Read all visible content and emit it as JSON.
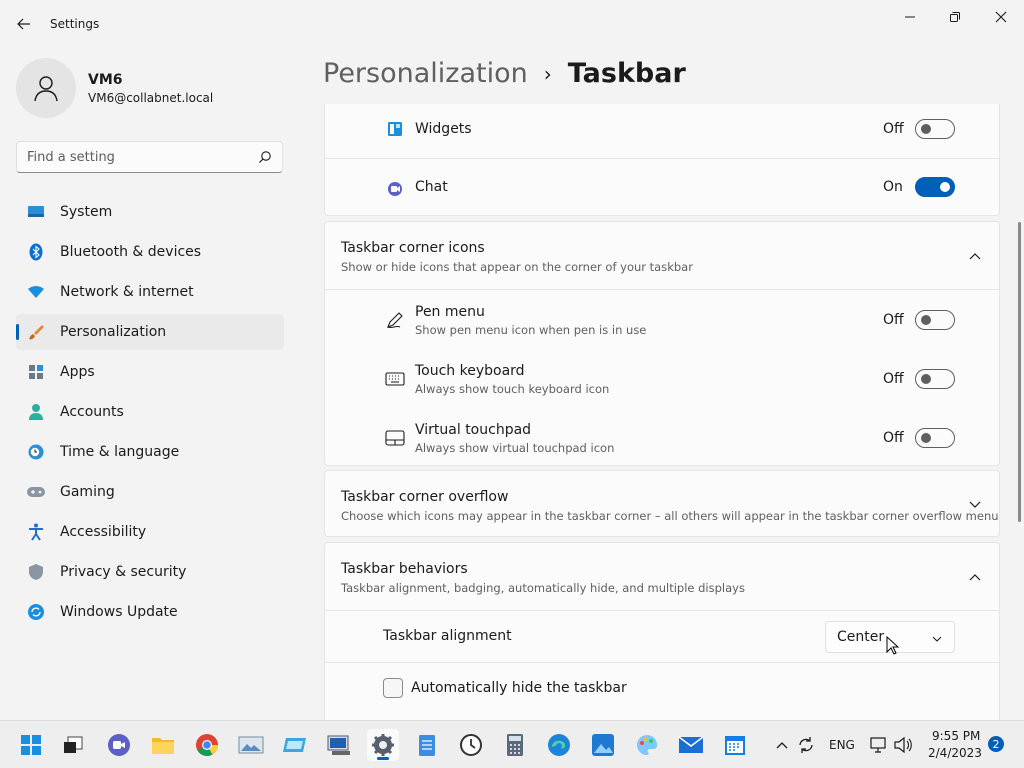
{
  "window": {
    "title": "Settings"
  },
  "profile": {
    "name": "VM6",
    "email": "VM6@collabnet.local"
  },
  "search": {
    "placeholder": "Find a setting"
  },
  "nav": {
    "items": [
      {
        "label": "System",
        "icon": "system-icon"
      },
      {
        "label": "Bluetooth & devices",
        "icon": "bluetooth-icon"
      },
      {
        "label": "Network & internet",
        "icon": "wifi-icon"
      },
      {
        "label": "Personalization",
        "icon": "brush-icon",
        "active": true
      },
      {
        "label": "Apps",
        "icon": "apps-icon"
      },
      {
        "label": "Accounts",
        "icon": "accounts-icon"
      },
      {
        "label": "Time & language",
        "icon": "clock-globe-icon"
      },
      {
        "label": "Gaming",
        "icon": "gamepad-icon"
      },
      {
        "label": "Accessibility",
        "icon": "accessibility-icon"
      },
      {
        "label": "Privacy & security",
        "icon": "shield-icon"
      },
      {
        "label": "Windows Update",
        "icon": "update-icon"
      }
    ]
  },
  "breadcrumb": {
    "parent": "Personalization",
    "separator": "›",
    "current": "Taskbar"
  },
  "taskbar_items": {
    "widgets": {
      "label": "Widgets",
      "state": "Off",
      "on": false
    },
    "chat": {
      "label": "Chat",
      "state": "On",
      "on": true
    }
  },
  "corner_icons": {
    "title": "Taskbar corner icons",
    "subtitle": "Show or hide icons that appear on the corner of your taskbar",
    "items": [
      {
        "label": "Pen menu",
        "sub": "Show pen menu icon when pen is in use",
        "state": "Off"
      },
      {
        "label": "Touch keyboard",
        "sub": "Always show touch keyboard icon",
        "state": "Off"
      },
      {
        "label": "Virtual touchpad",
        "sub": "Always show virtual touchpad icon",
        "state": "Off"
      }
    ]
  },
  "corner_overflow": {
    "title": "Taskbar corner overflow",
    "subtitle": "Choose which icons may appear in the taskbar corner – all others will appear in the taskbar corner overflow menu"
  },
  "behaviors": {
    "title": "Taskbar behaviors",
    "subtitle": "Taskbar alignment, badging, automatically hide, and multiple displays",
    "alignment_label": "Taskbar alignment",
    "alignment_value": "Center",
    "autohide_label": "Automatically hide the taskbar",
    "autohide_checked": false
  },
  "tray": {
    "language": "ENG",
    "time": "9:55 PM",
    "date": "2/4/2023",
    "notifications": "2"
  },
  "colors": {
    "accent": "#005fb8",
    "background": "#f3f3f3",
    "card": "#fbfbfb"
  }
}
